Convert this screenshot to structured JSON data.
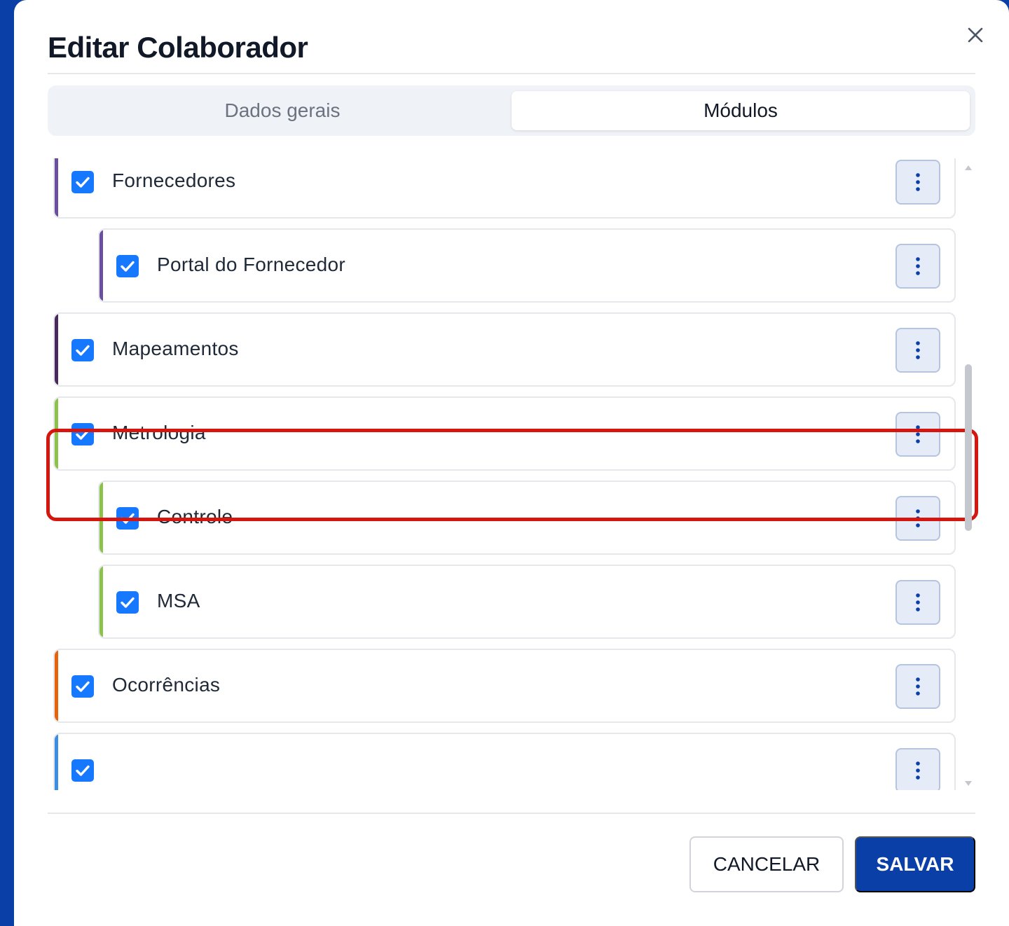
{
  "dialog": {
    "title": "Editar Colaborador",
    "close_icon": "close-icon"
  },
  "tabs": [
    {
      "label": "Dados gerais",
      "active": false
    },
    {
      "label": "Módulos",
      "active": true
    }
  ],
  "modules": [
    {
      "label": "",
      "checked": true,
      "accent": "#10c9a0",
      "level": 1
    },
    {
      "label": "Fornecedores",
      "checked": true,
      "accent": "#6a4fa0",
      "level": 1
    },
    {
      "label": "Portal do Fornecedor",
      "checked": true,
      "accent": "#6a4fa0",
      "level": 2
    },
    {
      "label": "Mapeamentos",
      "checked": true,
      "accent": "#4a2a5e",
      "level": 1
    },
    {
      "label": "Metrologia",
      "checked": true,
      "accent": "#8bc34a",
      "level": 1,
      "highlighted": true
    },
    {
      "label": "Controle",
      "checked": true,
      "accent": "#8bc34a",
      "level": 2
    },
    {
      "label": "MSA",
      "checked": true,
      "accent": "#8bc34a",
      "level": 2
    },
    {
      "label": "Ocorrências",
      "checked": true,
      "accent": "#e8620c",
      "level": 1
    },
    {
      "label": "",
      "checked": true,
      "accent": "#3a8ee6",
      "level": 1
    }
  ],
  "footer": {
    "cancel_label": "CANCELAR",
    "save_label": "SALVAR"
  },
  "colors": {
    "primary": "#0a3fa8",
    "checkbox": "#1677ff",
    "highlight": "#d7150f"
  }
}
